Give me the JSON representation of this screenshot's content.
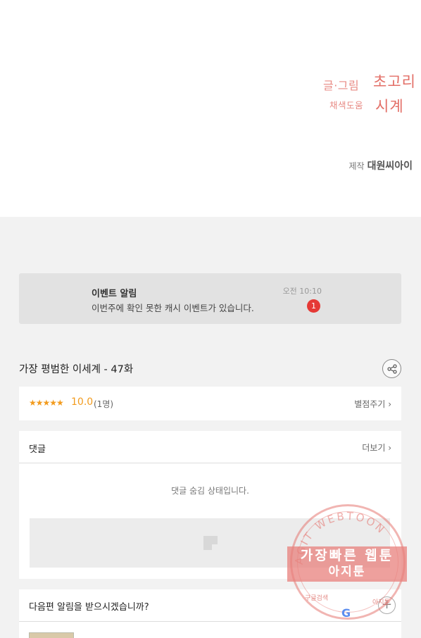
{
  "credits": {
    "story_art_label": "글·그림",
    "story_art_name": "초고리",
    "coloring_label": "채색도움",
    "coloring_name": "시계",
    "producer_label": "제작",
    "producer_name": "대원씨아이"
  },
  "event": {
    "title": "이벤트 알림",
    "message": "이번주에 확인 못한 캐시 이벤트가 있습니다.",
    "time": "오전 10:10",
    "badge": "1"
  },
  "episode": {
    "title": "가장 평범한 이세계 - 47화"
  },
  "rating": {
    "stars": "★★★★★",
    "score": "10.0",
    "count": "(1명)",
    "rate_link": "별점주기"
  },
  "comments": {
    "title": "댓글",
    "more_link": "더보기",
    "hidden_message": "댓글 숨김 상태입니다."
  },
  "notify": {
    "question": "다음편 알림을 받으시겠습니까?",
    "add_symbol": "+"
  },
  "watermark": {
    "arc_text": "AGIT WEBTOON",
    "line1": "가장빠른 웹툰",
    "line2": "아지툰",
    "bottom_left": "구글검색",
    "bottom_right": "아지툰",
    "google": "G"
  },
  "colors": {
    "accent_star": "#f29b1d",
    "credit_pink": "#e36f67",
    "badge_red": "#e53935"
  }
}
